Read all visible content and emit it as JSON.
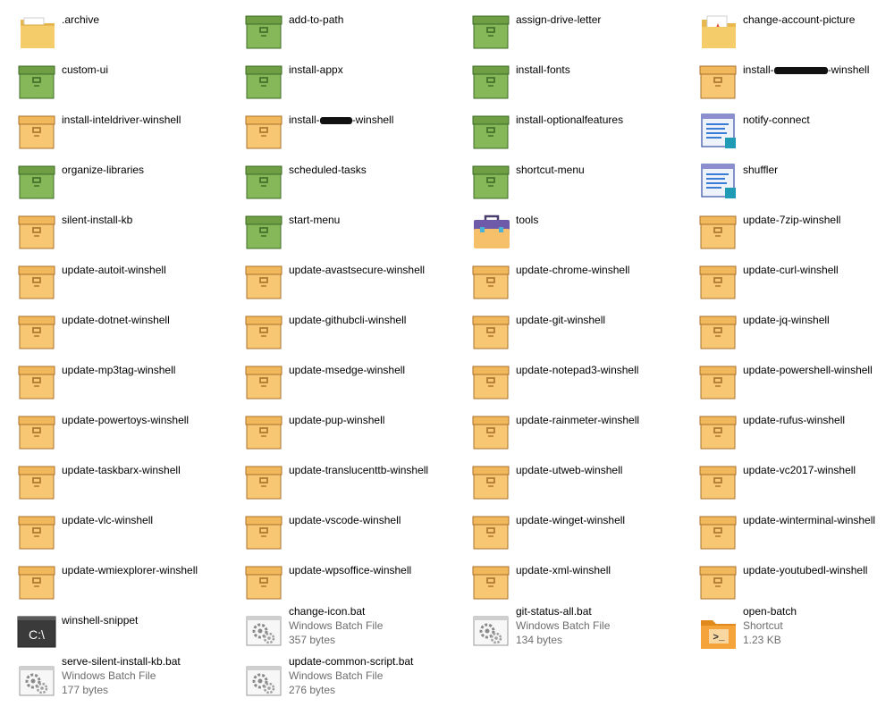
{
  "explorer": {
    "items": [
      {
        "name": "archive-folder",
        "label": ".archive",
        "icon": "folder-icon"
      },
      {
        "name": "add-to-path",
        "label": "add-to-path",
        "icon": "green-box-icon"
      },
      {
        "name": "assign-drive-letter",
        "label": "assign-drive-letter",
        "icon": "green-box-icon"
      },
      {
        "name": "change-account-picture",
        "label": "change-account-picture",
        "icon": "doc-folder-icon"
      },
      {
        "name": "custom-ui",
        "label": "custom-ui",
        "icon": "green-box-icon"
      },
      {
        "name": "install-appx",
        "label": "install-appx",
        "icon": "green-box-icon"
      },
      {
        "name": "install-fonts",
        "label": "install-fonts",
        "icon": "green-box-icon"
      },
      {
        "name": "install-redacted-winshell",
        "label": "install-",
        "label2": "-winshell",
        "icon": "orange-box-icon",
        "redact": 60
      },
      {
        "name": "install-inteldriver-winshell",
        "label": "install-inteldriver-winshell",
        "icon": "orange-box-icon"
      },
      {
        "name": "install-redacted2-winshell",
        "label": "install-",
        "label2": "-winshell",
        "icon": "orange-box-icon",
        "redact": 36
      },
      {
        "name": "install-optionalfeatures",
        "label": "install-optionalfeatures",
        "icon": "green-box-icon"
      },
      {
        "name": "notify-connect",
        "label": "notify-connect",
        "icon": "script-icon"
      },
      {
        "name": "organize-libraries",
        "label": "organize-libraries",
        "icon": "green-box-icon"
      },
      {
        "name": "scheduled-tasks",
        "label": "scheduled-tasks",
        "icon": "green-box-icon"
      },
      {
        "name": "shortcut-menu",
        "label": "shortcut-menu",
        "icon": "green-box-icon"
      },
      {
        "name": "shuffler",
        "label": "shuffler",
        "icon": "script-icon"
      },
      {
        "name": "silent-install-kb",
        "label": "silent-install-kb",
        "icon": "orange-box-icon"
      },
      {
        "name": "start-menu",
        "label": "start-menu",
        "icon": "green-box-icon"
      },
      {
        "name": "tools",
        "label": "tools",
        "icon": "toolbox-icon"
      },
      {
        "name": "update-7zip-winshell",
        "label": "update-7zip-winshell",
        "icon": "orange-box-icon"
      },
      {
        "name": "update-autoit-winshell",
        "label": "update-autoit-winshell",
        "icon": "orange-box-icon"
      },
      {
        "name": "update-avastsecure-winshell",
        "label": "update-avastsecure-winshell",
        "icon": "orange-box-icon"
      },
      {
        "name": "update-chrome-winshell",
        "label": "update-chrome-winshell",
        "icon": "orange-box-icon"
      },
      {
        "name": "update-curl-winshell",
        "label": "update-curl-winshell",
        "icon": "orange-box-icon"
      },
      {
        "name": "update-dotnet-winshell",
        "label": "update-dotnet-winshell",
        "icon": "orange-box-icon"
      },
      {
        "name": "update-githubcli-winshell",
        "label": "update-githubcli-winshell",
        "icon": "orange-box-icon"
      },
      {
        "name": "update-git-winshell",
        "label": "update-git-winshell",
        "icon": "orange-box-icon"
      },
      {
        "name": "update-jq-winshell",
        "label": "update-jq-winshell",
        "icon": "orange-box-icon"
      },
      {
        "name": "update-mp3tag-winshell",
        "label": "update-mp3tag-winshell",
        "icon": "orange-box-icon"
      },
      {
        "name": "update-msedge-winshell",
        "label": "update-msedge-winshell",
        "icon": "orange-box-icon"
      },
      {
        "name": "update-notepad3-winshell",
        "label": "update-notepad3-winshell",
        "icon": "orange-box-icon"
      },
      {
        "name": "update-powershell-winshell",
        "label": "update-powershell-winshell",
        "icon": "orange-box-icon"
      },
      {
        "name": "update-powertoys-winshell",
        "label": "update-powertoys-winshell",
        "icon": "orange-box-icon"
      },
      {
        "name": "update-pup-winshell",
        "label": "update-pup-winshell",
        "icon": "orange-box-icon"
      },
      {
        "name": "update-rainmeter-winshell",
        "label": "update-rainmeter-winshell",
        "icon": "orange-box-icon"
      },
      {
        "name": "update-rufus-winshell",
        "label": "update-rufus-winshell",
        "icon": "orange-box-icon"
      },
      {
        "name": "update-taskbarx-winshell",
        "label": "update-taskbarx-winshell",
        "icon": "orange-box-icon"
      },
      {
        "name": "update-translucenttb-winshell",
        "label": "update-translucenttb-winshell",
        "icon": "orange-box-icon"
      },
      {
        "name": "update-utweb-winshell",
        "label": "update-utweb-winshell",
        "icon": "orange-box-icon"
      },
      {
        "name": "update-vc2017-winshell",
        "label": "update-vc2017-winshell",
        "icon": "orange-box-icon"
      },
      {
        "name": "update-vlc-winshell",
        "label": "update-vlc-winshell",
        "icon": "orange-box-icon"
      },
      {
        "name": "update-vscode-winshell",
        "label": "update-vscode-winshell",
        "icon": "orange-box-icon"
      },
      {
        "name": "update-winget-winshell",
        "label": "update-winget-winshell",
        "icon": "orange-box-icon"
      },
      {
        "name": "update-winterminal-winshell",
        "label": "update-winterminal-winshell",
        "icon": "orange-box-icon"
      },
      {
        "name": "update-wmiexplorer-winshell",
        "label": "update-wmiexplorer-winshell",
        "icon": "orange-box-icon"
      },
      {
        "name": "update-wpsoffice-winshell",
        "label": "update-wpsoffice-winshell",
        "icon": "orange-box-icon"
      },
      {
        "name": "update-xml-winshell",
        "label": "update-xml-winshell",
        "icon": "orange-box-icon"
      },
      {
        "name": "update-youtubedl-winshell",
        "label": "update-youtubedl-winshell",
        "icon": "orange-box-icon"
      },
      {
        "name": "winshell-snippet",
        "label": "winshell-snippet",
        "icon": "console-icon",
        "cmd_glyph": "C:\\"
      },
      {
        "name": "change-icon-bat",
        "label": "change-icon.bat",
        "icon": "batch-gear-icon",
        "type": "Windows Batch File",
        "size": "357 bytes"
      },
      {
        "name": "git-status-all-bat",
        "label": "git-status-all.bat",
        "icon": "batch-gear-icon",
        "type": "Windows Batch File",
        "size": "134 bytes"
      },
      {
        "name": "open-batch-shortcut",
        "label": "open-batch",
        "icon": "terminal-folder-icon",
        "type": "Shortcut",
        "size": "1.23 KB",
        "prompt_glyph": ">_"
      },
      {
        "name": "serve-silent-install-kb-bat",
        "label": "serve-silent-install-kb.bat",
        "icon": "batch-gear-icon",
        "type": "Windows Batch File",
        "size": "177 bytes"
      },
      {
        "name": "update-common-script-bat",
        "label": "update-common-script.bat",
        "icon": "batch-gear-icon",
        "type": "Windows Batch File",
        "size": "276 bytes"
      }
    ]
  },
  "colors": {
    "green_box": "#7aad4f",
    "orange_box": "#f6c06b",
    "folder": "#f4cc6a",
    "text_secondary": "#6d6d6d"
  }
}
